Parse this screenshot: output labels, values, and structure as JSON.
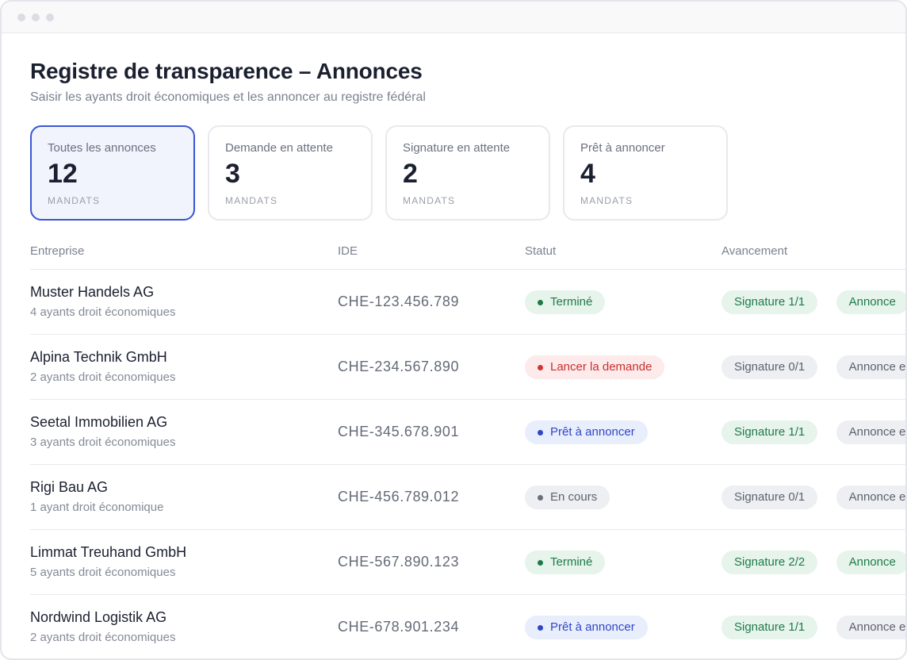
{
  "header": {
    "title": "Registre de transparence – Annonces",
    "subtitle": "Saisir les ayants droit économiques et les annoncer au registre fédéral"
  },
  "cards": [
    {
      "label": "Toutes les annonces",
      "count": "12",
      "unit": "MANDATS",
      "active": true
    },
    {
      "label": "Demande en attente",
      "count": "3",
      "unit": "MANDATS",
      "active": false
    },
    {
      "label": "Signature en attente",
      "count": "2",
      "unit": "MANDATS",
      "active": false
    },
    {
      "label": "Prêt à annoncer",
      "count": "4",
      "unit": "MANDATS",
      "active": false
    }
  ],
  "table": {
    "columns": [
      "Entreprise",
      "IDE",
      "Statut",
      "Avancement"
    ],
    "rows": [
      {
        "name": "Muster Handels AG",
        "sub": "4 ayants droit économiques",
        "ide": "CHE-123.456.789",
        "status": "Terminé",
        "status_color": "#1f7a48",
        "progress": [
          {
            "label": "Signature 1/1",
            "tone": "green"
          },
          {
            "label": "Annonce",
            "tone": "green"
          }
        ]
      },
      {
        "name": "Alpina Technik GmbH",
        "sub": "2 ayants droit économiques",
        "ide": "CHE-234.567.890",
        "status": "Lancer la demande",
        "status_color": "#c93030",
        "progress": [
          {
            "label": "Signature 0/1",
            "tone": "gray"
          },
          {
            "label": "Annonce en",
            "tone": "gray"
          }
        ]
      },
      {
        "name": "Seetal Immobilien AG",
        "sub": "3 ayants droit économiques",
        "ide": "CHE-345.678.901",
        "status": "Prêt à annoncer",
        "status_color": "#3046c8",
        "progress": [
          {
            "label": "Signature 1/1",
            "tone": "green"
          },
          {
            "label": "Annonce en",
            "tone": "gray"
          }
        ]
      },
      {
        "name": "Rigi Bau AG",
        "sub": "1 ayant droit économique",
        "ide": "CHE-456.789.012",
        "status": "En cours",
        "status_color": "#5d6270",
        "progress": [
          {
            "label": "Signature 0/1",
            "tone": "gray"
          },
          {
            "label": "Annonce en",
            "tone": "gray"
          }
        ]
      },
      {
        "name": "Limmat Treuhand GmbH",
        "sub": "5 ayants droit économiques",
        "ide": "CHE-567.890.123",
        "status": "Terminé",
        "status_color": "#1f7a48",
        "progress": [
          {
            "label": "Signature 2/2",
            "tone": "green"
          },
          {
            "label": "Annonce",
            "tone": "green"
          }
        ]
      },
      {
        "name": "Nordwind Logistik AG",
        "sub": "2 ayants droit économiques",
        "ide": "CHE-678.901.234",
        "status": "Prêt à annoncer",
        "status_color": "#3046c8",
        "progress": [
          {
            "label": "Signature 1/1",
            "tone": "green"
          },
          {
            "label": "Annonce en",
            "tone": "gray"
          }
        ]
      }
    ]
  }
}
